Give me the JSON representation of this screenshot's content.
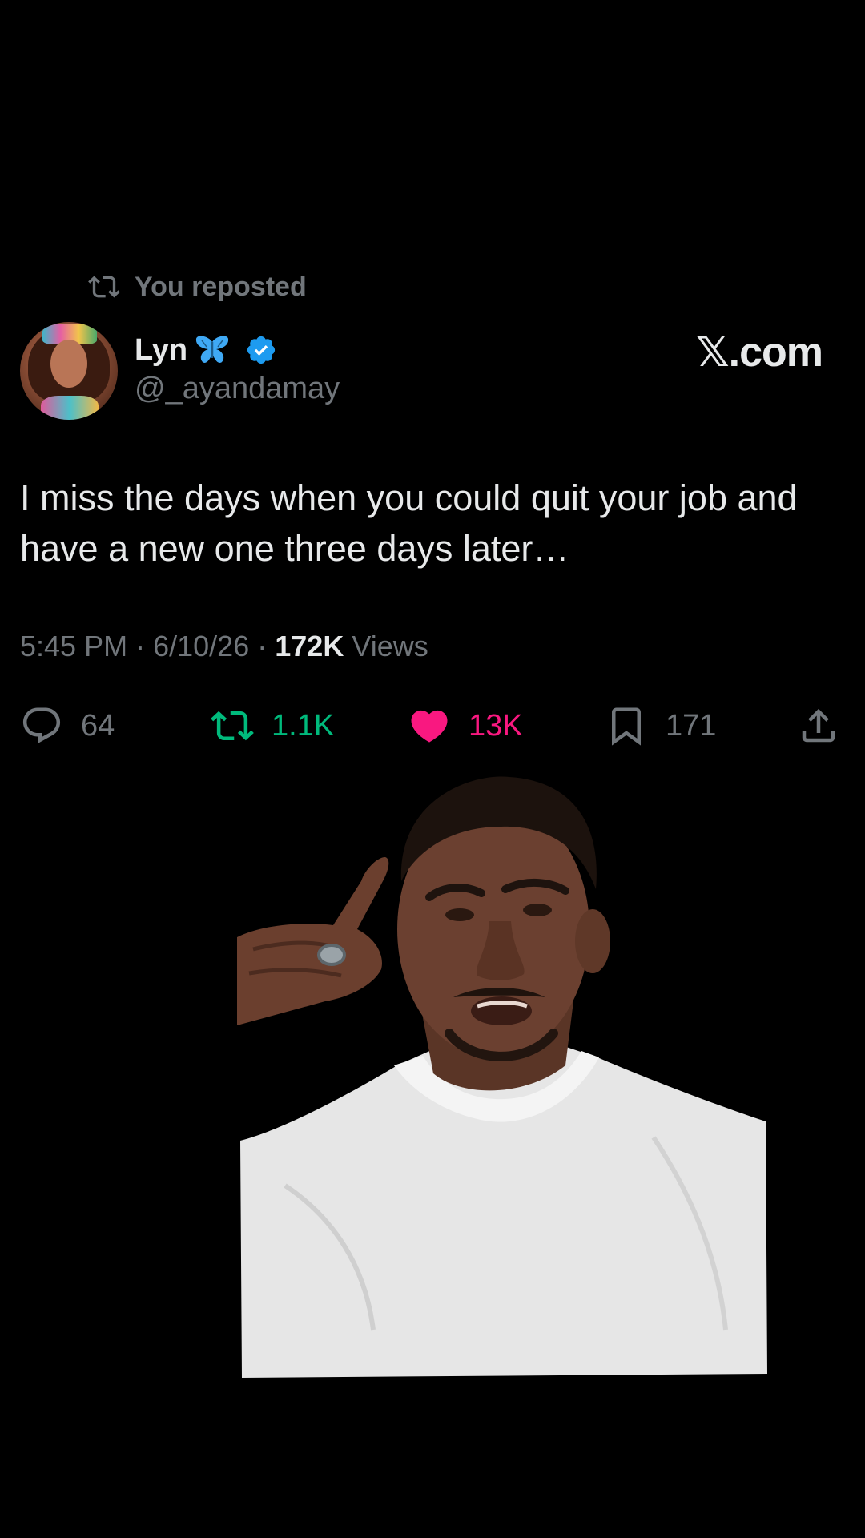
{
  "repost": {
    "icon": "repost-icon",
    "label": "You reposted"
  },
  "author": {
    "name": "Lyn",
    "emoji_icon": "butterfly-icon",
    "verified_icon": "verified-badge-icon",
    "handle": "@_ayandamay"
  },
  "brand": {
    "label": "𝕏.com"
  },
  "tweet": {
    "text": "I miss the days when you could quit your job and have a new one three days later…"
  },
  "meta": {
    "time": "5:45 PM",
    "separator": "·",
    "date": "6/10/26",
    "views_count": "172K",
    "views_label": "Views"
  },
  "actions": {
    "reply": {
      "icon": "reply-icon",
      "count": "64"
    },
    "retweet": {
      "icon": "retweet-icon",
      "count": "1.1K",
      "active": true,
      "color": "#00ba7c"
    },
    "like": {
      "icon": "heart-icon",
      "count": "13K",
      "active": true,
      "color": "#f91880"
    },
    "bookmark": {
      "icon": "bookmark-icon",
      "count": "171"
    },
    "share": {
      "icon": "share-icon"
    }
  },
  "colors": {
    "background": "#000000",
    "text_primary": "#e7e9ea",
    "text_secondary": "#71767b",
    "verified_blue": "#1d9bf0"
  }
}
